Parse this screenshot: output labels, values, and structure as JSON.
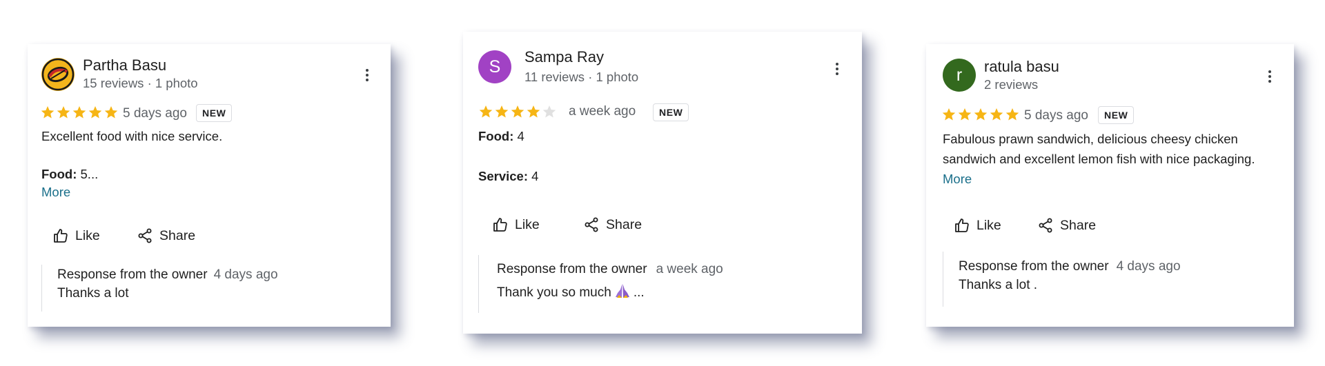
{
  "reviews": [
    {
      "name": "Partha Basu",
      "meta": "15 reviews · 1 photo",
      "avatar": {
        "type": "logo",
        "icon": "restaurant-logo-icon"
      },
      "rating": 5,
      "time": "5 days ago",
      "badge": "NEW",
      "text": "Excellent food with nice service.",
      "food_label": "Food:",
      "food_value": " 5...",
      "more": "More",
      "like": "Like",
      "share": "Share",
      "response_title": "Response from the owner",
      "response_time": "4 days ago",
      "response_text": "Thanks a lot"
    },
    {
      "name": "Sampa Ray",
      "meta": "11 reviews · 1 photo",
      "avatar": {
        "type": "letter",
        "letter": "S",
        "color": "#a142c4"
      },
      "rating": 4,
      "time": "a week ago",
      "badge": "NEW",
      "food_label": "Food:",
      "food_value": " 4",
      "service_label": "Service:",
      "service_value": " 4",
      "like": "Like",
      "share": "Share",
      "response_title": "Response from the owner",
      "response_time": "a week ago",
      "response_text": "Thank you so much",
      "response_emoji": "folded-hands-icon",
      "response_suffix": "..."
    },
    {
      "name": "ratula basu",
      "meta": "2 reviews",
      "avatar": {
        "type": "letter",
        "letter": "r",
        "color": "#33691e"
      },
      "rating": 5,
      "time": "5 days ago",
      "badge": "NEW",
      "text": "Fabulous prawn sandwich, delicious cheesy chicken sandwich and excellent lemon fish with nice packaging.",
      "more": "More",
      "like": "Like",
      "share": "Share",
      "response_title": "Response from the owner",
      "response_time": "4 days ago",
      "response_text": "Thanks a lot ."
    }
  ],
  "colors": {
    "star_filled": "#f6b515",
    "star_empty": "#e0e0e0",
    "link": "#1a6f8a",
    "secondary_text": "#5f6368"
  }
}
